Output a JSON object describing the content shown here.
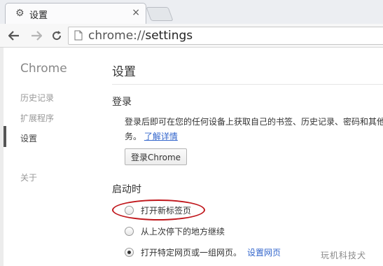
{
  "tab": {
    "title": "设置",
    "icon": "gear-icon",
    "close": "×"
  },
  "toolbar": {
    "back_icon": "back-arrow-icon",
    "forward_icon": "forward-arrow-icon",
    "reload_icon": "reload-icon",
    "url_host": "chrome://",
    "url_path": "settings"
  },
  "sidebar": {
    "title": "Chrome",
    "items": [
      {
        "label": "历史记录"
      },
      {
        "label": "扩展程序"
      },
      {
        "label": "设置",
        "selected": true
      },
      {
        "label": "关于"
      }
    ]
  },
  "main": {
    "title": "设置",
    "signin": {
      "heading": "登录",
      "desc_line1": "登录后即可在您的任何设备上获取自己的书签、历史记录、密码和其他",
      "desc_line2": "务。",
      "learn_more": "了解详情",
      "button": "登录Chrome"
    },
    "startup": {
      "heading": "启动时",
      "options": [
        {
          "label": "打开新标签页",
          "checked": false
        },
        {
          "label": "从上次停下的地方继续",
          "checked": false
        },
        {
          "label": "打开特定网页或一组网页。",
          "checked": true,
          "link": "设置网页"
        }
      ]
    }
  },
  "watermark": "玩机科技犬",
  "colors": {
    "link": "#3366cc",
    "highlight_circle": "#c0171c"
  }
}
